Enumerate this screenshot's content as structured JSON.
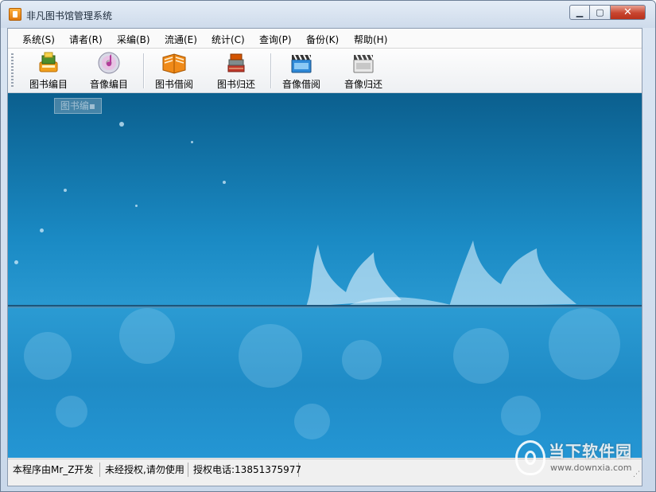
{
  "window": {
    "title": "非凡图书馆管理系统"
  },
  "menu": {
    "items": [
      {
        "label": "系统(S)"
      },
      {
        "label": "请者(R)"
      },
      {
        "label": "采编(B)"
      },
      {
        "label": "流通(E)"
      },
      {
        "label": "统计(C)"
      },
      {
        "label": "查询(P)"
      },
      {
        "label": "备份(K)"
      },
      {
        "label": "帮助(H)"
      }
    ]
  },
  "toolbar": {
    "buttons": [
      {
        "label": "图书编目",
        "icon": "book-catalog-icon"
      },
      {
        "label": "音像编目",
        "icon": "cd-catalog-icon"
      },
      {
        "label": "图书借阅",
        "icon": "book-borrow-icon"
      },
      {
        "label": "图书归还",
        "icon": "book-return-icon"
      },
      {
        "label": "音像借阅",
        "icon": "video-borrow-icon"
      },
      {
        "label": "音像归还",
        "icon": "video-return-icon"
      }
    ]
  },
  "mdi": {
    "minimized_window_label": "图书编▪"
  },
  "statusbar": {
    "panels": [
      {
        "text": "本程序由Mr_Z开发"
      },
      {
        "text": "未经授权,请勿使用"
      },
      {
        "text": "授权电话:13851375977"
      }
    ]
  },
  "watermark": {
    "brand": "当下软件园",
    "url": "www.downxia.com"
  },
  "colors": {
    "background_top": "#0b5f8e",
    "background_mid": "#2a9ad2",
    "close_button": "#c8452f"
  }
}
